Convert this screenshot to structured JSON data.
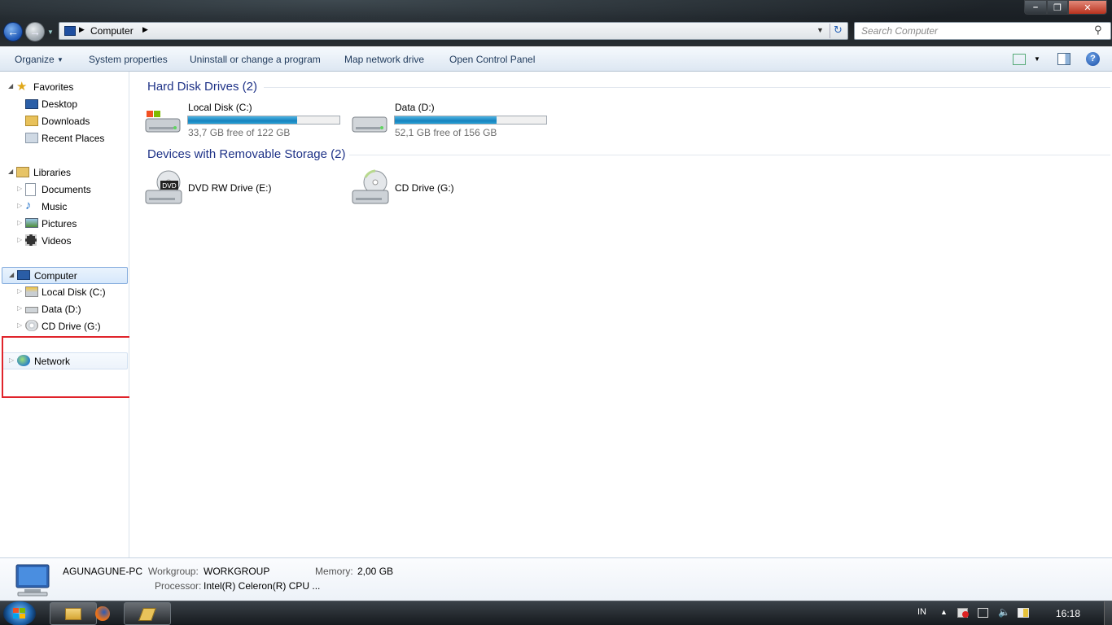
{
  "address": {
    "location": "Computer"
  },
  "search": {
    "placeholder": "Search Computer"
  },
  "command_bar": {
    "organize": "Organize",
    "system_properties": "System properties",
    "uninstall": "Uninstall or change a program",
    "map_network_drive": "Map network drive",
    "open_control_panel": "Open Control Panel"
  },
  "nav": {
    "favorites": "Favorites",
    "desktop": "Desktop",
    "downloads": "Downloads",
    "recent_places": "Recent Places",
    "libraries": "Libraries",
    "documents": "Documents",
    "music": "Music",
    "pictures": "Pictures",
    "videos": "Videos",
    "computer": "Computer",
    "local_disk": "Local Disk (C:)",
    "data": "Data (D:)",
    "cd_drive": "CD Drive (G:)",
    "network": "Network"
  },
  "content": {
    "hdd_group": "Hard Disk Drives (2)",
    "removable_group": "Devices with Removable Storage (2)",
    "drives": [
      {
        "name": "Local Disk (C:)",
        "free": "33,7 GB free of 122 GB",
        "used_fraction": 0.72
      },
      {
        "name": "Data (D:)",
        "free": "52,1 GB free of 156 GB",
        "used_fraction": 0.67
      }
    ],
    "removable": [
      {
        "name": "DVD RW Drive (E:)",
        "badge": "DVD"
      },
      {
        "name": "CD Drive (G:)"
      }
    ]
  },
  "details": {
    "pc_name": "AGUNAGUNE-PC",
    "workgroup_label": "Workgroup:",
    "workgroup": "WORKGROUP",
    "memory_label": "Memory:",
    "memory": "2,00 GB",
    "processor_label": "Processor:",
    "processor": "Intel(R) Celeron(R) CPU ..."
  },
  "taskbar": {
    "language": "IN",
    "clock": "16:18"
  },
  "colors": {
    "accent": "#1e3287",
    "highlight_box": "#e0242b",
    "progress": "#26a0d7"
  }
}
